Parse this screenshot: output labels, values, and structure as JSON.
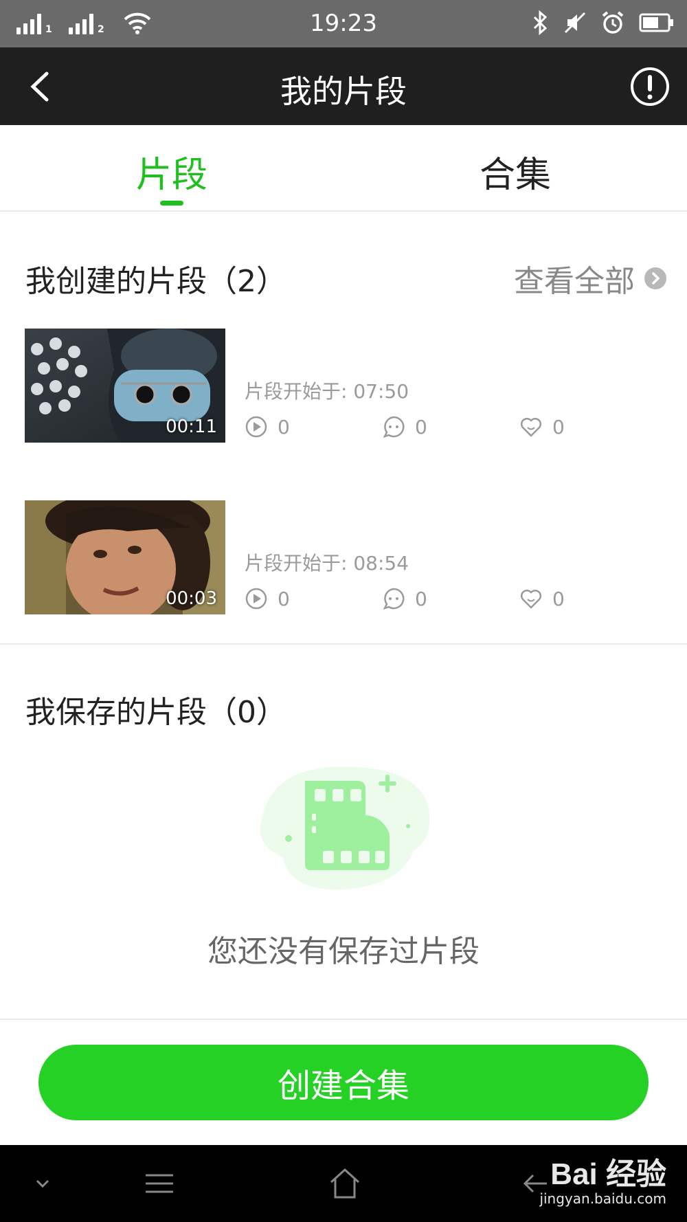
{
  "status_bar": {
    "time": "19:23",
    "sim1": "1",
    "sim2": "2",
    "icons": [
      "signal-icon",
      "wifi-icon",
      "bluetooth-icon",
      "mute-icon",
      "alarm-icon",
      "battery-icon"
    ]
  },
  "nav": {
    "title": "我的片段",
    "back_icon": "chevron-left-icon",
    "info_icon": "info-icon"
  },
  "tabs": [
    {
      "label": "片段",
      "active": true
    },
    {
      "label": "合集",
      "active": false
    }
  ],
  "created_section": {
    "title": "我创建的片段（2）",
    "view_all": "查看全部"
  },
  "clips": [
    {
      "duration": "00:11",
      "start": "片段开始于: 07:50",
      "plays": "0",
      "comments": "0",
      "likes": "0"
    },
    {
      "duration": "00:03",
      "start": "片段开始于: 08:54",
      "plays": "0",
      "comments": "0",
      "likes": "0"
    }
  ],
  "saved_section": {
    "title": "我保存的片段（0）",
    "empty_text": "您还没有保存过片段"
  },
  "create_button": "创建合集",
  "system_nav": [
    "chevron-down-icon",
    "menu-icon",
    "home-icon",
    "back-icon"
  ],
  "watermark": {
    "main": "Bai 经验",
    "sub": "jingyan.baidu.com"
  },
  "colors": {
    "accent": "#1fbf1f",
    "button": "#25d125",
    "nav_bg": "#1f1f1f",
    "status_bg": "#6a6a6a"
  }
}
